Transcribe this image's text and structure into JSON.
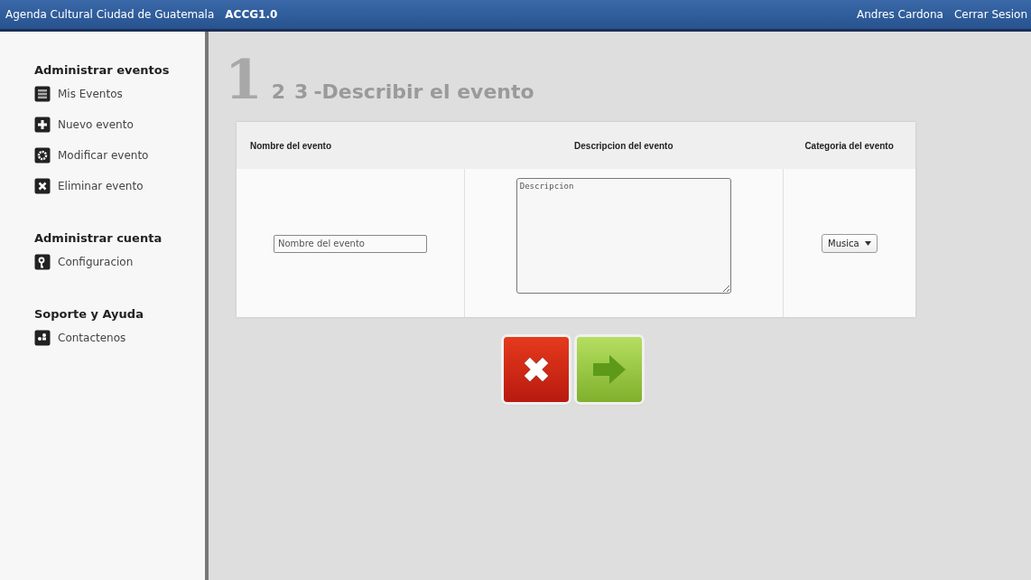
{
  "top_bar": {
    "app_name": "Agenda Cultural Ciudad de Guatemala",
    "version": "ACCG1.0",
    "user": "Andres Cardona",
    "logout": "Cerrar Sesion"
  },
  "sidebar": {
    "sections": [
      {
        "heading": "Administrar eventos",
        "items": [
          {
            "label": "Mis Eventos",
            "kind": "list"
          },
          {
            "label": "Nuevo evento",
            "kind": "plus"
          },
          {
            "label": "Modificar evento",
            "kind": "gear"
          },
          {
            "label": "Eliminar evento",
            "kind": "x"
          }
        ]
      },
      {
        "heading": "Administrar cuenta",
        "items": [
          {
            "label": "Configuracion",
            "kind": "key"
          }
        ]
      },
      {
        "heading": "Soporte y Ayuda",
        "items": [
          {
            "label": "Contactenos",
            "kind": "people"
          }
        ]
      }
    ]
  },
  "steps": [
    {
      "label": "1",
      "selected": true
    },
    {
      "label": "2",
      "selected": false
    },
    {
      "label": "3",
      "selected": false
    }
  ],
  "step_title": "-Describir el evento",
  "form": {
    "columns": [
      "Nombre del evento",
      "Descripcion del evento",
      "Categoria del evento"
    ],
    "name_field": {
      "placeholder": "Nombre del evento"
    },
    "description_field": {
      "placeholder": "Descripcion"
    },
    "category_select": {
      "value": "Musica"
    }
  },
  "buttons": [
    {
      "kind": "cancel"
    },
    {
      "kind": "next"
    }
  ]
}
